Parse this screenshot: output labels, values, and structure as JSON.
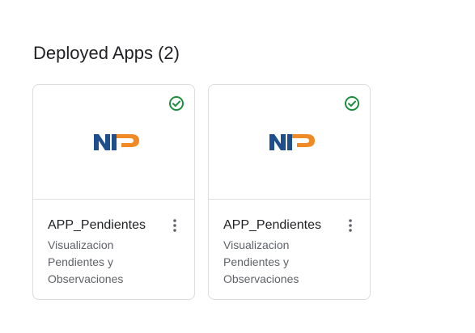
{
  "section": {
    "title": "Deployed Apps (2)"
  },
  "apps": [
    {
      "name": "APP_Pendientes",
      "description": "Visualizacion Pendientes y Observaciones",
      "status_icon": "check-circle-icon",
      "menu_icon": "more-vert-icon",
      "logo_icon": "np-logo-icon",
      "logo_text": "NP"
    },
    {
      "name": "APP_Pendientes",
      "description": "Visualizacion Pendientes y Observaciones",
      "status_icon": "check-circle-icon",
      "menu_icon": "more-vert-icon",
      "logo_icon": "np-logo-icon",
      "logo_text": "NP"
    }
  ],
  "colors": {
    "status_ok": "#1e8e3e",
    "logo_blue": "#1f4e8c",
    "logo_orange": "#f08a24",
    "text_primary": "#202124",
    "text_secondary": "#5f6368",
    "border": "#dadce0"
  }
}
